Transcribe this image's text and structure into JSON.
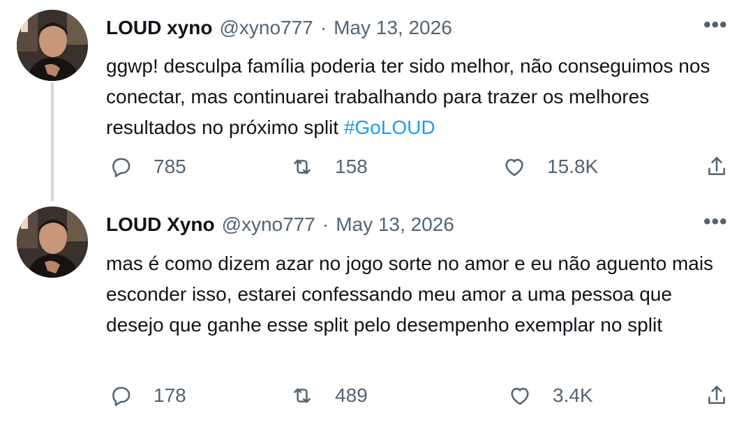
{
  "tweets": [
    {
      "display_name": "LOUD xyno",
      "handle": "@xyno777",
      "separator": "·",
      "date": "May 13, 2026",
      "more_icon": "more-dots-icon",
      "text": "ggwp! desculpa família poderia ter sido melhor, não conseguimos nos conectar, mas continuarei trabalhando para trazer os melhores resultados no próximo split ",
      "hashtag": "#GoLOUD",
      "replies": "785",
      "retweets": "158",
      "likes": "15.8K"
    },
    {
      "display_name": "LOUD Xyno",
      "handle": "@xyno777",
      "separator": "·",
      "date": "May 13, 2026",
      "more_icon": "more-dots-icon",
      "text": "mas é como dizem azar no jogo sorte no amor e eu não aguento mais esconder isso, estarei confessando meu amor a uma pessoa que desejo que ganhe esse split pelo desempenho exemplar no split",
      "hashtag": "",
      "replies": "178",
      "retweets": "489",
      "likes": "3.4K"
    }
  ],
  "colors": {
    "text": "#0f1419",
    "secondary": "#536471",
    "link": "#1d9bf0",
    "thread_line": "#cfd9de"
  },
  "icons": [
    "reply-icon",
    "retweet-icon",
    "like-icon",
    "share-icon",
    "more-dots-icon"
  ]
}
